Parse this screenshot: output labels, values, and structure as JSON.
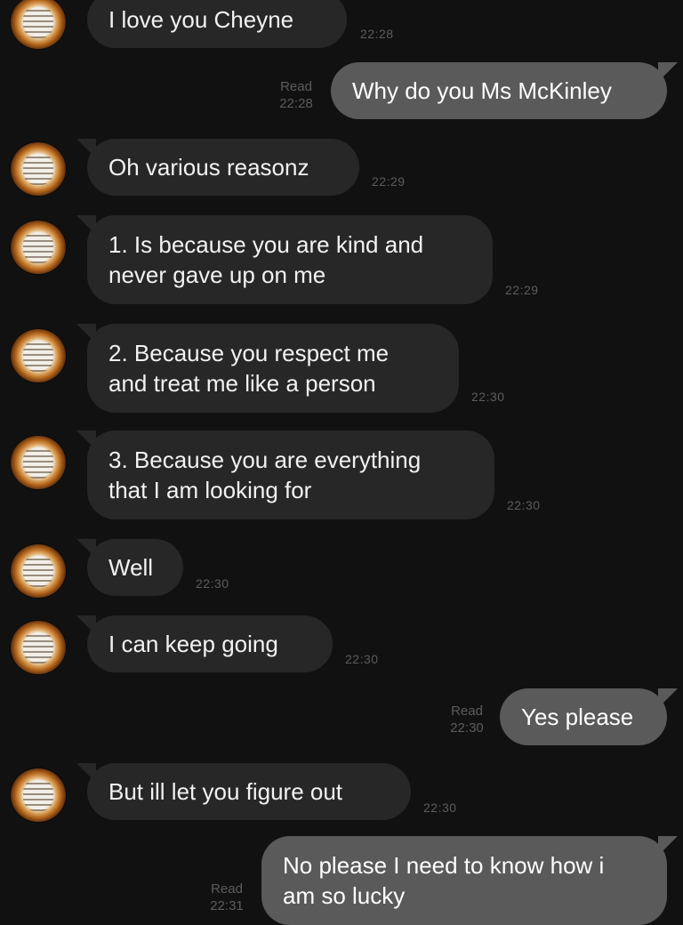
{
  "messages": [
    {
      "id": "m1",
      "direction": "in",
      "text": "I love you Cheyne",
      "time": "22:28"
    },
    {
      "id": "m2",
      "direction": "out",
      "text": "Why do you Ms McKinley",
      "read_label": "Read",
      "time": "22:28"
    },
    {
      "id": "m3",
      "direction": "in",
      "text": "Oh various reasonz",
      "time": "22:29"
    },
    {
      "id": "m4",
      "direction": "in",
      "lines": [
        "1. Is because you are kind and",
        "never gave up on me"
      ],
      "time": "22:29"
    },
    {
      "id": "m5",
      "direction": "in",
      "lines": [
        "2. Because you respect me",
        "and treat me like a person"
      ],
      "time": "22:30"
    },
    {
      "id": "m6",
      "direction": "in",
      "lines": [
        "3. Because you are everything",
        "that I am looking for"
      ],
      "time": "22:30"
    },
    {
      "id": "m7",
      "direction": "in",
      "text": "Well",
      "time": "22:30"
    },
    {
      "id": "m8",
      "direction": "in",
      "text": "I can keep going",
      "time": "22:30"
    },
    {
      "id": "m9",
      "direction": "out",
      "text": "Yes please",
      "read_label": "Read",
      "time": "22:30"
    },
    {
      "id": "m10",
      "direction": "in",
      "text": "But ill let you figure out",
      "time": "22:30"
    },
    {
      "id": "m11",
      "direction": "out",
      "lines": [
        "No please I need to know how i",
        "am so lucky"
      ],
      "read_label": "Read",
      "time": "22:31"
    }
  ],
  "avatar_icon": "contact-avatar-icon",
  "colors": {
    "background": "#111111",
    "incoming_bubble": "#272727",
    "outgoing_bubble": "#5a5a5a",
    "timestamp": "#5c5c5c"
  }
}
